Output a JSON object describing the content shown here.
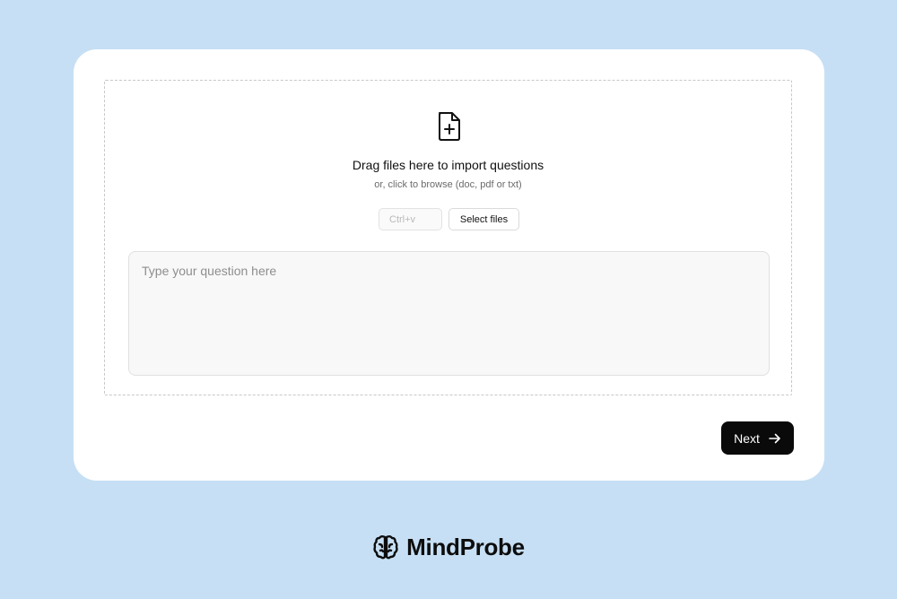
{
  "upload": {
    "icon": "file-plus-icon",
    "title": "Drag files here to import questions",
    "subtitle": "or, click to browse (doc, pdf or txt)",
    "paste_label": "Ctrl+v",
    "select_label": "Select files"
  },
  "question": {
    "placeholder": "Type your question here",
    "value": ""
  },
  "actions": {
    "next_label": "Next",
    "next_icon": "arrow-right-icon"
  },
  "brand": {
    "logo_icon": "brain-icon",
    "name": "MindProbe"
  },
  "colors": {
    "background": "#c6dff4",
    "card": "#ffffff",
    "primary_button": "#0a0a0a"
  }
}
